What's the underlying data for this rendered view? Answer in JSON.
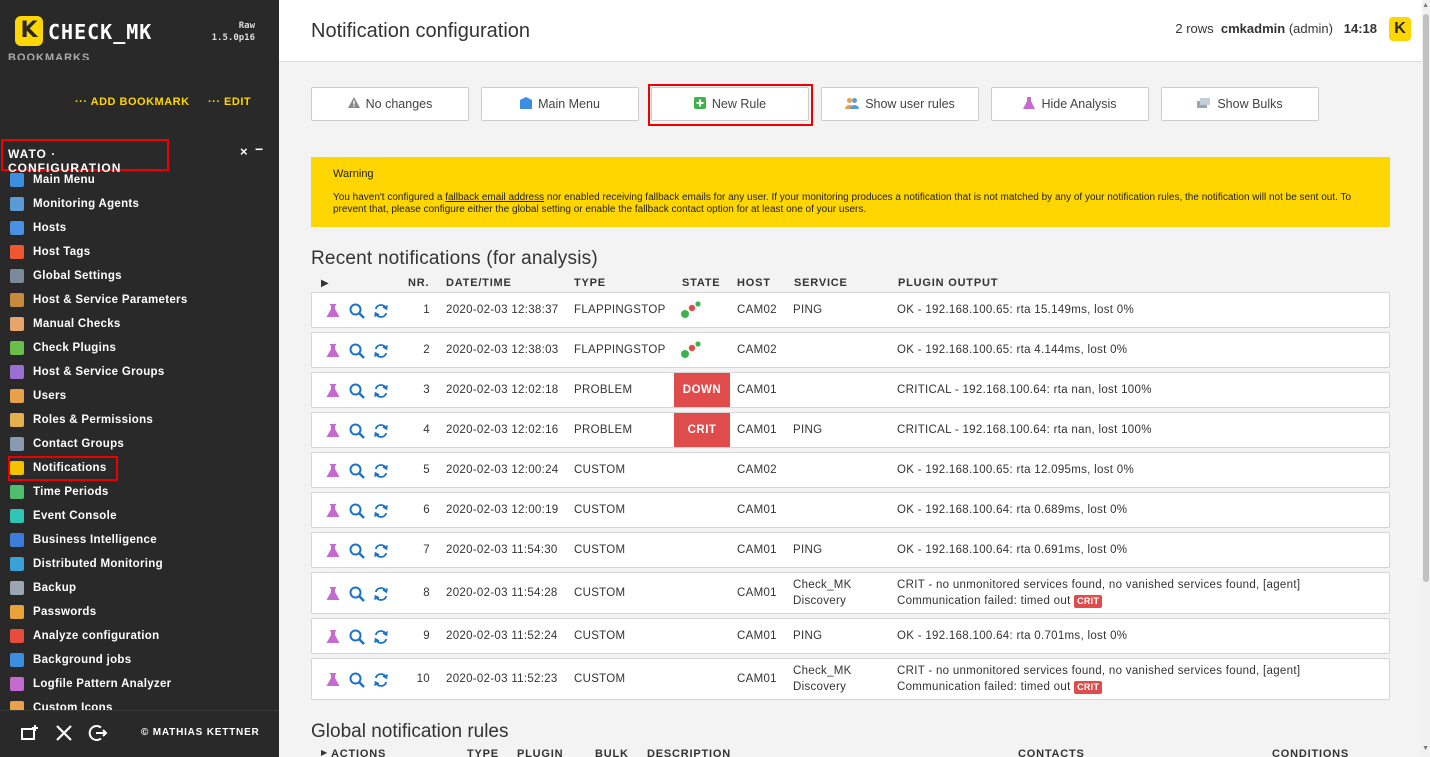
{
  "sidebar": {
    "logo_letter": "K",
    "logo_text": "CHECK_MK",
    "version_line1": "Raw",
    "version_line2": "1.5.0p16",
    "bookmarks_label": "BOOKMARKS",
    "add_bookmark": "··· ADD BOOKMARK",
    "edit": "··· EDIT",
    "wato_title": "WATO · CONFIGURATION",
    "close_glyph": "×",
    "minimize_glyph": "−",
    "items": [
      {
        "label": "Main Menu",
        "icon": "main-menu-icon",
        "color": "#3b8ee0"
      },
      {
        "label": "Monitoring Agents",
        "icon": "agents-icon",
        "color": "#5b9bd5"
      },
      {
        "label": "Hosts",
        "icon": "hosts-icon",
        "color": "#4a90e2"
      },
      {
        "label": "Host Tags",
        "icon": "tag-icon",
        "color": "#f0562f"
      },
      {
        "label": "Global Settings",
        "icon": "gear-icon",
        "color": "#7a8a99"
      },
      {
        "label": "Host & Service Parameters",
        "icon": "parameters-icon",
        "color": "#c88a3c"
      },
      {
        "label": "Manual Checks",
        "icon": "hand-icon",
        "color": "#e7a56c"
      },
      {
        "label": "Check Plugins",
        "icon": "plugin-icon",
        "color": "#6abf4b"
      },
      {
        "label": "Host & Service Groups",
        "icon": "groups-icon",
        "color": "#9b6fcf"
      },
      {
        "label": "Users",
        "icon": "users-icon",
        "color": "#e8a04a"
      },
      {
        "label": "Roles & Permissions",
        "icon": "roles-icon",
        "color": "#e3b04b"
      },
      {
        "label": "Contact Groups",
        "icon": "contact-groups-icon",
        "color": "#8a9bb0"
      },
      {
        "label": "Notifications",
        "icon": "bell-icon",
        "color": "#f5c000"
      },
      {
        "label": "Time Periods",
        "icon": "clock-icon",
        "color": "#4fbf6f"
      },
      {
        "label": "Event Console",
        "icon": "event-console-icon",
        "color": "#2ec4b6"
      },
      {
        "label": "Business Intelligence",
        "icon": "bi-icon",
        "color": "#3b7dd8"
      },
      {
        "label": "Distributed Monitoring",
        "icon": "globe-icon",
        "color": "#3aa1d8"
      },
      {
        "label": "Backup",
        "icon": "backup-icon",
        "color": "#9aa6b2"
      },
      {
        "label": "Passwords",
        "icon": "key-icon",
        "color": "#e8a23a"
      },
      {
        "label": "Analyze configuration",
        "icon": "heart-check-icon",
        "color": "#e74c3c"
      },
      {
        "label": "Background jobs",
        "icon": "list-icon",
        "color": "#3b8ee0"
      },
      {
        "label": "Logfile Pattern Analyzer",
        "icon": "flask-icon",
        "color": "#c56bd0"
      },
      {
        "label": "Custom Icons",
        "icon": "custom-icons-icon",
        "color": "#e8a04a"
      }
    ],
    "copyright": "© MATHIAS KETTNER"
  },
  "header": {
    "title": "Notification configuration",
    "rows": "2 rows",
    "user": "cmkadmin",
    "role": "(admin)",
    "time": "14:18",
    "logo_letter": "K"
  },
  "buttons": [
    {
      "label": "No changes",
      "icon": "warning-icon"
    },
    {
      "label": "Main Menu",
      "icon": "main-menu-icon"
    },
    {
      "label": "New Rule",
      "icon": "new-rule-icon"
    },
    {
      "label": "Show user rules",
      "icon": "users-icon"
    },
    {
      "label": "Hide Analysis",
      "icon": "flask-icon"
    },
    {
      "label": "Show Bulks",
      "icon": "bulks-icon"
    }
  ],
  "warning": {
    "title": "Warning",
    "text_before": "You haven't configured a ",
    "link": "fallback email address",
    "text_after": " nor enabled receiving fallback emails for any user. If your monitoring produces a notification that is not matched by any of your notification rules, the notification will not be sent out. To prevent that, please configure either the global setting or enable the fallback contact option for at least one of your users."
  },
  "recent": {
    "title": "Recent notifications (for analysis)",
    "expand_glyph": "▶",
    "columns": [
      "NR.",
      "DATE/TIME",
      "TYPE",
      "STATE",
      "HOST",
      "SERVICE",
      "PLUGIN OUTPUT"
    ],
    "rows": [
      {
        "nr": "1",
        "datetime": "2020-02-03 12:38:37",
        "type": "FLAPPINGSTOP",
        "state": "",
        "host": "CAM02",
        "service": "PING",
        "output": "OK - 192.168.100.65: rta 15.149ms, lost 0%"
      },
      {
        "nr": "2",
        "datetime": "2020-02-03 12:38:03",
        "type": "FLAPPINGSTOP",
        "state": "",
        "host": "CAM02",
        "service": "",
        "output": "OK - 192.168.100.65: rta 4.144ms, lost 0%"
      },
      {
        "nr": "3",
        "datetime": "2020-02-03 12:02:18",
        "type": "PROBLEM",
        "state": "DOWN",
        "host": "CAM01",
        "service": "",
        "output": "CRITICAL - 192.168.100.64: rta nan, lost 100%"
      },
      {
        "nr": "4",
        "datetime": "2020-02-03 12:02:16",
        "type": "PROBLEM",
        "state": "CRIT",
        "host": "CAM01",
        "service": "PING",
        "output": "CRITICAL - 192.168.100.64: rta nan, lost 100%"
      },
      {
        "nr": "5",
        "datetime": "2020-02-03 12:00:24",
        "type": "CUSTOM",
        "state": "",
        "host": "CAM02",
        "service": "",
        "output": "OK - 192.168.100.65: rta 12.095ms, lost 0%"
      },
      {
        "nr": "6",
        "datetime": "2020-02-03 12:00:19",
        "type": "CUSTOM",
        "state": "",
        "host": "CAM01",
        "service": "",
        "output": "OK - 192.168.100.64: rta 0.689ms, lost 0%"
      },
      {
        "nr": "7",
        "datetime": "2020-02-03 11:54:30",
        "type": "CUSTOM",
        "state": "",
        "host": "CAM01",
        "service": "PING",
        "output": "OK - 192.168.100.64: rta 0.691ms, lost 0%"
      },
      {
        "nr": "8",
        "datetime": "2020-02-03 11:54:28",
        "type": "CUSTOM",
        "state": "",
        "host": "CAM01",
        "service": "Check_MK",
        "service2": "Discovery",
        "output": "CRIT - no unmonitored services found, no vanished services found, [agent]",
        "output2": "Communication failed: timed out",
        "badge": "CRIT"
      },
      {
        "nr": "9",
        "datetime": "2020-02-03 11:52:24",
        "type": "CUSTOM",
        "state": "",
        "host": "CAM01",
        "service": "PING",
        "output": "OK - 192.168.100.64: rta 0.701ms, lost 0%"
      },
      {
        "nr": "10",
        "datetime": "2020-02-03 11:52:23",
        "type": "CUSTOM",
        "state": "",
        "host": "CAM01",
        "service": "Check_MK",
        "service2": "Discovery",
        "output": "CRIT - no unmonitored services found, no vanished services found, [agent]",
        "output2": "Communication failed: timed out",
        "badge": "CRIT"
      }
    ]
  },
  "global": {
    "title": "Global notification rules",
    "columns": [
      "ACTIONS",
      "TYPE",
      "PLUGIN",
      "BULK",
      "DESCRIPTION",
      "CONTACTS",
      "CONDITIONS"
    ]
  },
  "colors": {
    "accent": "#ffd600",
    "sidebar_bg": "#292929",
    "crit": "#e04c4c",
    "highlight_border": "#ee0000",
    "ok_dot": "#3cb44b",
    "crit_dot": "#e04c4c"
  }
}
